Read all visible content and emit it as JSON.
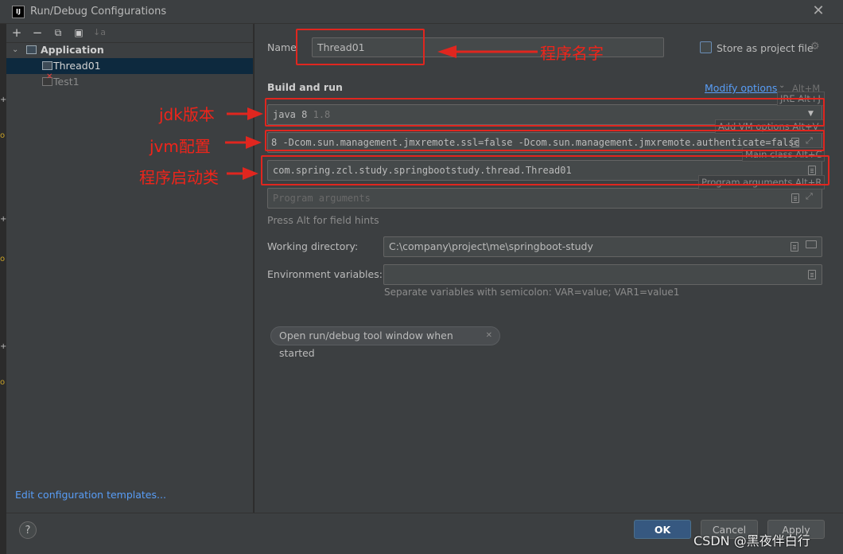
{
  "window": {
    "title": "Run/Debug Configurations",
    "logo_text": "IJ"
  },
  "left_toolbar": {
    "add": "+",
    "remove": "−",
    "copy": "⧉",
    "folder": "▣",
    "sort": "↓a"
  },
  "tree": {
    "group": "Application",
    "items": [
      {
        "label": "Thread01"
      },
      {
        "label": "Test1"
      }
    ]
  },
  "edit_templates_link": "Edit configuration templates...",
  "form": {
    "name_label": "Name",
    "name_value": "Thread01",
    "store_label": "Store as project file",
    "section_title": "Build and run",
    "modify_options": "Modify options",
    "modify_shortcut": "Alt+M",
    "jre_value": "java 8",
    "jre_version": "1.8",
    "jre_tip": "JRE Alt+J",
    "vm_options_value": "8 -Dcom.sun.management.jmxremote.ssl=false -Dcom.sun.management.jmxremote.authenticate=false",
    "vm_tip": "Add VM options Alt+V",
    "main_class_value": "com.spring.zcl.study.springbootstudy.thread.Thread01",
    "main_class_tip": "Main class Alt+C",
    "program_args_placeholder": "Program arguments",
    "program_args_tip": "Program arguments Alt+R",
    "hint": "Press Alt for field hints",
    "working_dir_label": "Working directory:",
    "working_dir_value": "C:\\company\\project\\me\\springboot-study",
    "env_label": "Environment variables:",
    "env_value": "",
    "env_hint": "Separate variables with semicolon: VAR=value; VAR1=value1",
    "open_tool_window_chip": "Open run/debug tool window when started"
  },
  "buttons": {
    "ok": "OK",
    "cancel": "Cancel",
    "apply": "Apply",
    "help": "?"
  },
  "annotations": {
    "program_name": "程序名字",
    "jdk_version": "jdk版本",
    "jvm_config": "jvm配置",
    "main_class": "程序启动类"
  },
  "watermark": "CSDN @黑夜伴白行",
  "colors": {
    "accent": "#365880",
    "link": "#589df6",
    "annotation_red": "#e0261f",
    "selection": "#0d293e"
  }
}
